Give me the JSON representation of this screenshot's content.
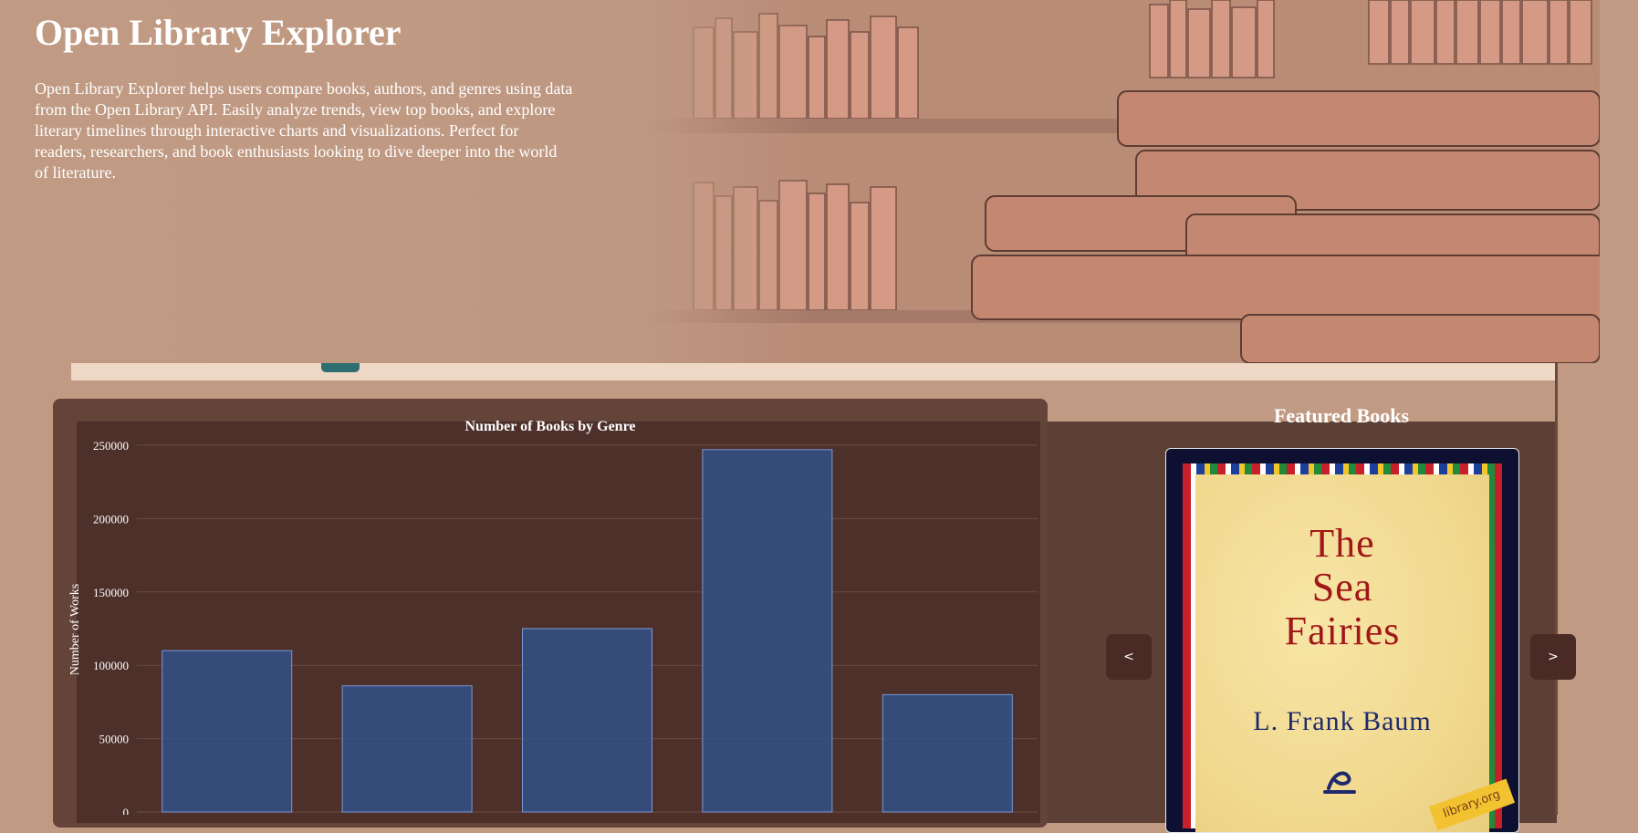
{
  "header": {
    "title": "Open Library Explorer",
    "description": "Open Library Explorer helps users compare books, authors, and genres using data from the Open Library API. Easily analyze trends, view top books, and explore literary timelines through interactive charts and visualizations. Perfect for readers, researchers, and book enthusiasts looking to dive deeper into the world of literature."
  },
  "featured": {
    "title": "Featured Books",
    "prev_label": "<",
    "next_label": ">",
    "book": {
      "cover_title": "The\nSea\nFairies",
      "cover_author": "L. Frank Baum",
      "publisher_tag": "library.org"
    }
  },
  "colors": {
    "bar_fill": "#2f528c",
    "bar_stroke": "#7a98d4",
    "accent_tab": "#2f6e6f"
  },
  "chart_data": {
    "type": "bar",
    "title": "Number of Books by Genre",
    "ylabel": "Number of Works",
    "xlabel": "",
    "ylim": [
      0,
      250000
    ],
    "yticks": [
      0,
      50000,
      100000,
      150000,
      200000,
      250000
    ],
    "grid": true,
    "values": [
      110000,
      86000,
      125000,
      247000,
      80000
    ]
  }
}
